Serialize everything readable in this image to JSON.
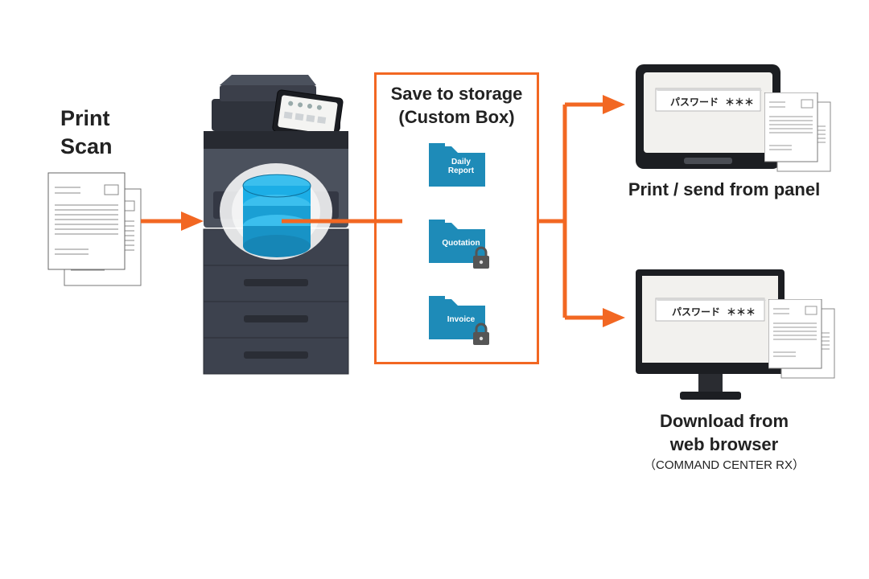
{
  "left_label": {
    "line1": "Print",
    "line2": "Scan"
  },
  "storage": {
    "title_line1": "Save to storage",
    "title_line2": "(Custom Box)",
    "folders": [
      {
        "name": "Daily Report",
        "locked": false
      },
      {
        "name": "Quotation",
        "locked": true
      },
      {
        "name": "Invoice",
        "locked": true
      }
    ]
  },
  "panel": {
    "caption": "Print / send from panel",
    "password_label": "パスワード",
    "password_mask": "＊＊＊"
  },
  "browser": {
    "caption_line1": "Download from",
    "caption_line2": "web browser",
    "caption_sub": "（COMMAND CENTER RX）",
    "password_label": "パスワード",
    "password_mask": "＊＊＊"
  },
  "colors": {
    "accent": "#f26722",
    "folder": "#1e8bb8",
    "cylinder": "#1caee6",
    "mfp_dark": "#3b3f4a",
    "mfp_mid": "#4b515d"
  }
}
